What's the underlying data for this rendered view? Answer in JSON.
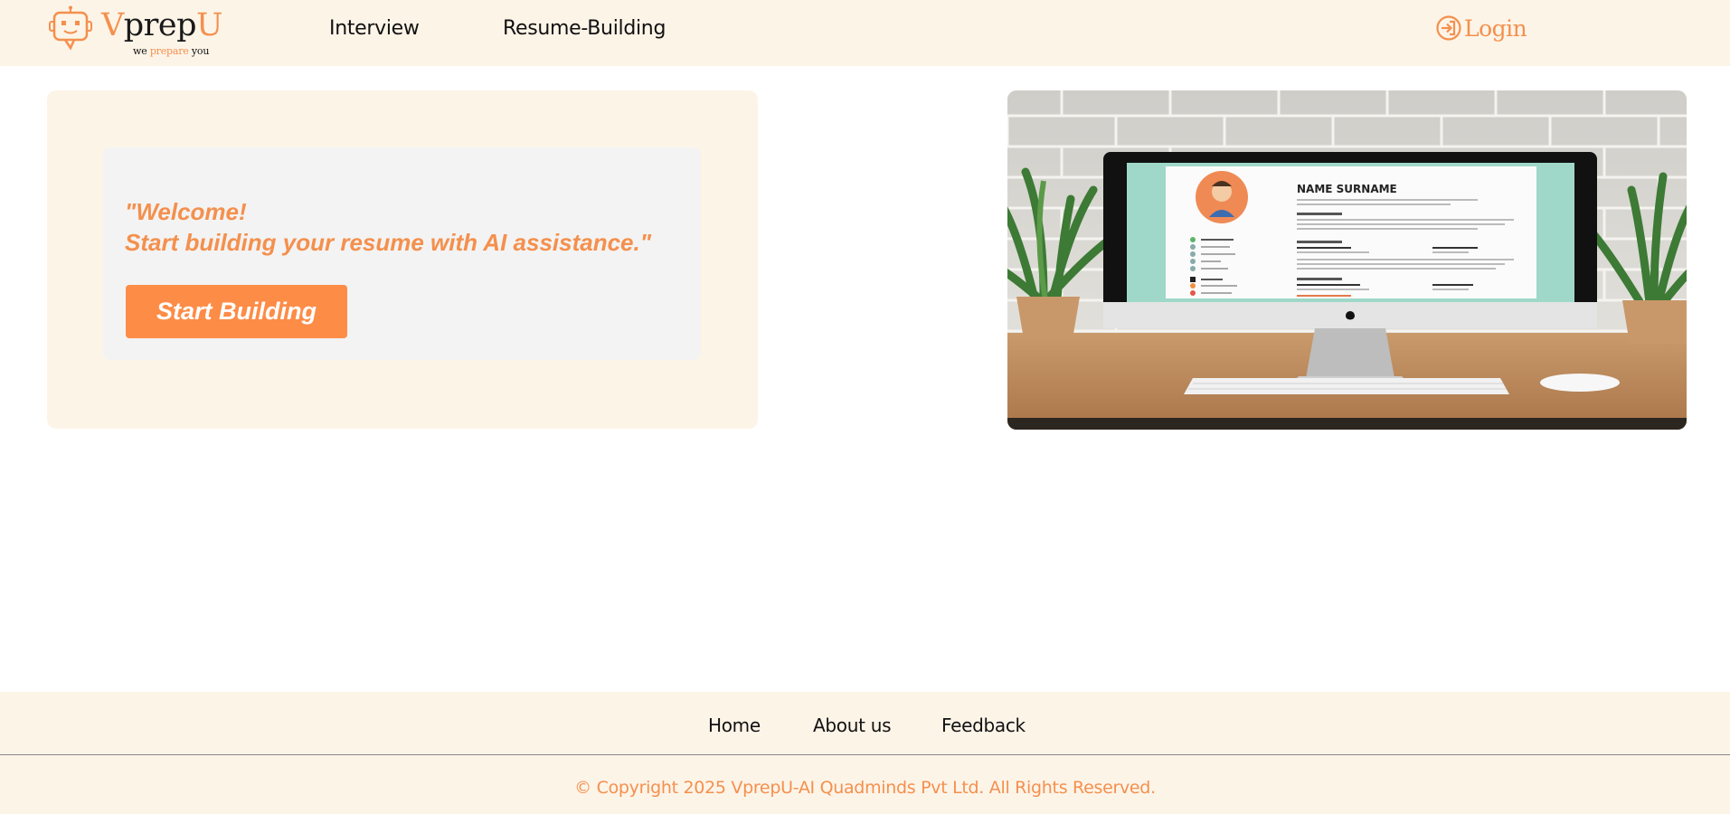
{
  "header": {
    "logo": {
      "brand_prefix": "V",
      "brand_middle": "prep",
      "brand_suffix": "U",
      "tagline_start": "we ",
      "tagline_middle": "prepare",
      "tagline_end": " you"
    },
    "nav": [
      {
        "label": "Interview"
      },
      {
        "label": "Resume-Building"
      }
    ],
    "login_label": "Login"
  },
  "main": {
    "welcome_line1": "\"Welcome!",
    "welcome_line2": "Start building your resume with AI assistance.\"",
    "start_button_label": "Start Building",
    "hero_image": {
      "resume_name": "NAME SURNAME",
      "description": "Desktop computer on a wooden desk showing a resume template, with potted plants and a white brick wall"
    }
  },
  "footer": {
    "links": [
      {
        "label": "Home"
      },
      {
        "label": "About us"
      },
      {
        "label": "Feedback"
      }
    ],
    "copyright": "© Copyright 2025 VprepU-AI Quadminds Pvt Ltd. All Rights Reserved."
  },
  "colors": {
    "accent": "#f4904d",
    "button": "#fd8c47",
    "header_bg": "#fdf4e8",
    "inner_bg": "#f3f3f3"
  }
}
